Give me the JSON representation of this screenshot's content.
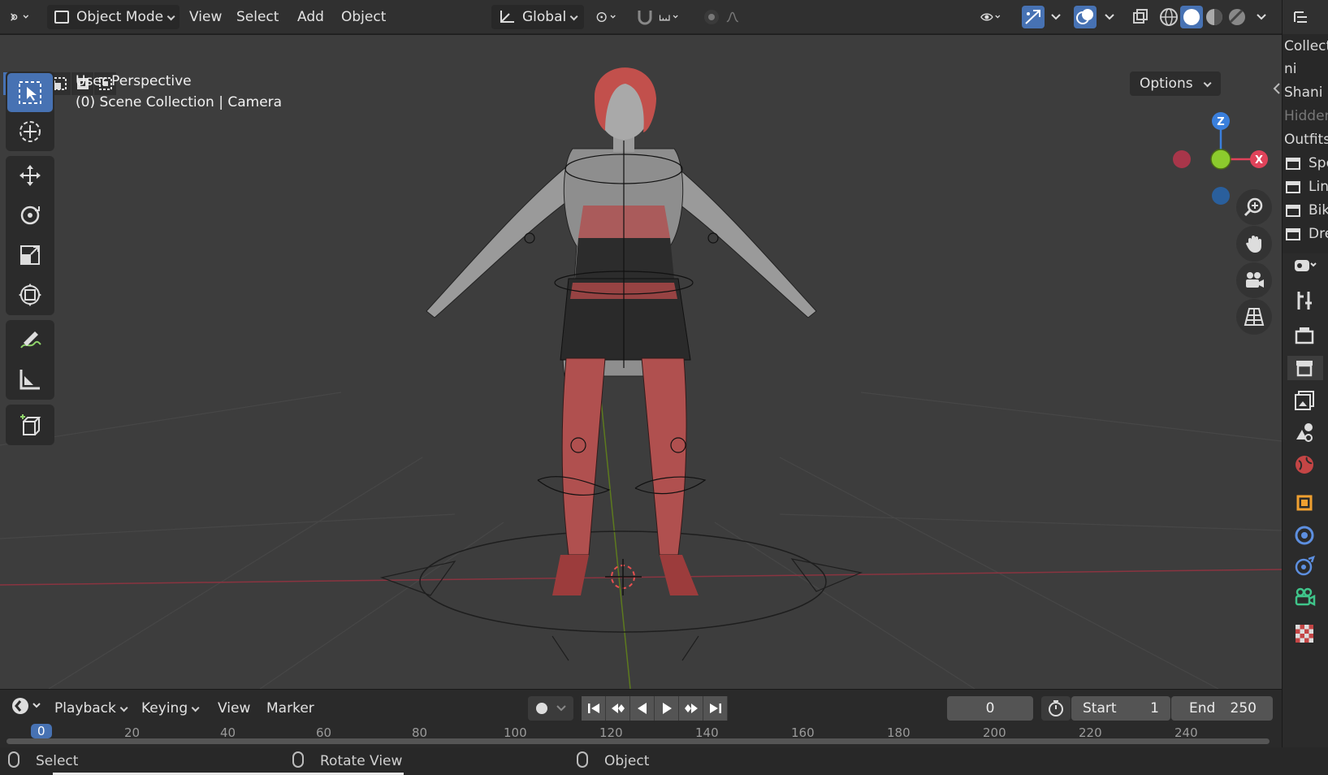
{
  "header": {
    "mode": "Object Mode",
    "menus": [
      "View",
      "Select",
      "Add",
      "Object"
    ],
    "orientation": "Global"
  },
  "viewport": {
    "perspective_label": "User Perspective",
    "collection_label": "(0) Scene Collection | Camera",
    "options_label": "Options",
    "gizmo": {
      "z": "Z",
      "x": "X"
    }
  },
  "outliner": {
    "rows": [
      "Collecti",
      "ni",
      "Shani &",
      "Hidden",
      "Outfits",
      "Spo",
      "Lin",
      "Bik",
      "Dre"
    ]
  },
  "timeline": {
    "menus": [
      "Playback",
      "Keying",
      "View",
      "Marker"
    ],
    "current_frame": "0",
    "start_label": "Start",
    "start_value": "1",
    "end_label": "End",
    "end_value": "250",
    "ticks": [
      "0",
      "20",
      "40",
      "60",
      "80",
      "100",
      "120",
      "140",
      "160",
      "180",
      "200",
      "220",
      "240"
    ]
  },
  "statusbar": {
    "select": "Select",
    "rotate": "Rotate View",
    "object": "Object"
  },
  "colors": {
    "accent": "#4772b3",
    "x_axis": "#e0435a",
    "y_axis": "#8ccb2d",
    "z_axis": "#3a7fdc"
  }
}
